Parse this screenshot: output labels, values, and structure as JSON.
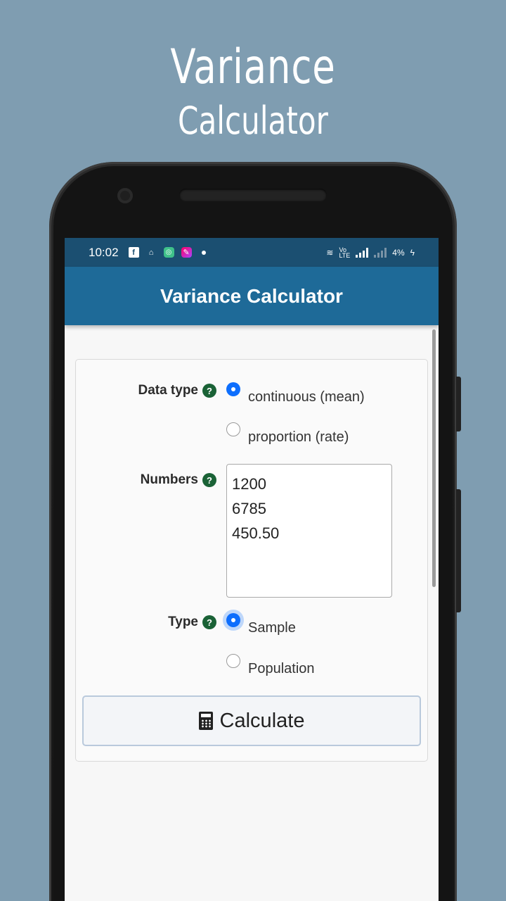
{
  "promo": {
    "title_line1": "Variance",
    "title_line2": "Calculator"
  },
  "statusbar": {
    "time": "10:02",
    "battery": "4%"
  },
  "appbar": {
    "title": "Variance Calculator"
  },
  "form": {
    "data_type": {
      "label": "Data type",
      "options": [
        "continuous (mean)",
        "proportion (rate)"
      ],
      "selected": "continuous (mean)"
    },
    "numbers": {
      "label": "Numbers",
      "lines": [
        "1200",
        "6785",
        "450.50"
      ]
    },
    "type": {
      "label": "Type",
      "options": [
        "Sample",
        "Population"
      ],
      "selected": "Sample"
    },
    "calculate_label": "Calculate"
  },
  "colors": {
    "accent": "#0d6efd",
    "appbar": "#1e6a98",
    "help": "#1a6236"
  }
}
